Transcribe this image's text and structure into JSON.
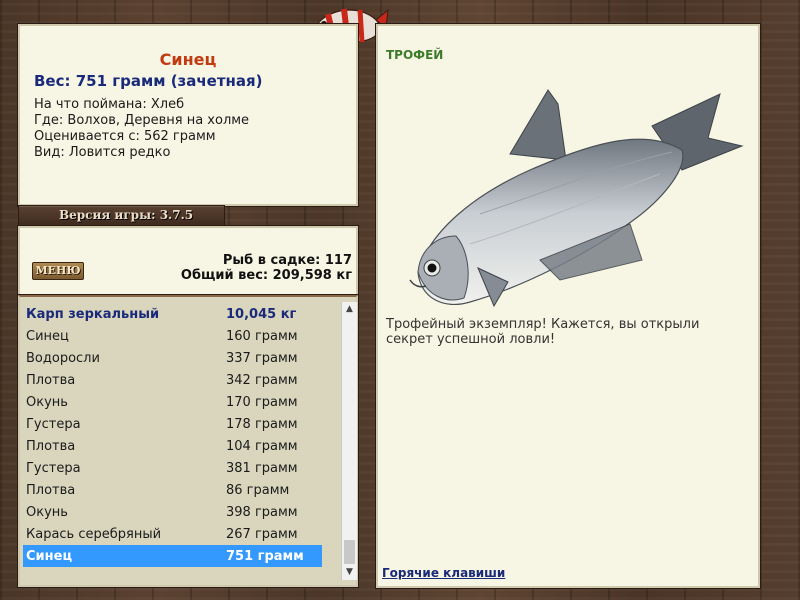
{
  "catch": {
    "name": "Синец",
    "weight": "Вес: 751 грамм (зачетная)",
    "bait": "На что поймана: Хлеб",
    "place": "Где: Волхов, Деревня на холме",
    "rated_from": "Оценивается с: 562 грамм",
    "kind": "Вид: Ловится редко"
  },
  "version": {
    "label": "Версия игры: 3.7.5"
  },
  "menu": {
    "label": "МЕНЮ"
  },
  "stats": {
    "count": "Рыб в садке: 117",
    "total": "Общий вес: 209,598 кг"
  },
  "list": {
    "header": {
      "name": "Карп зеркальный",
      "weight": "10,045 кг"
    },
    "items": [
      {
        "name": "Синец",
        "weight": "160 грамм"
      },
      {
        "name": "Водоросли",
        "weight": "337 грамм"
      },
      {
        "name": "Плотва",
        "weight": "342 грамм"
      },
      {
        "name": "Окунь",
        "weight": "170 грамм"
      },
      {
        "name": "Густера",
        "weight": "178 грамм"
      },
      {
        "name": "Плотва",
        "weight": "104 грамм"
      },
      {
        "name": "Густера",
        "weight": "381 грамм"
      },
      {
        "name": "Плотва",
        "weight": "86 грамм"
      },
      {
        "name": "Окунь",
        "weight": "398 грамм"
      },
      {
        "name": "Карась серебряный",
        "weight": "267 грамм"
      },
      {
        "name": "Синец",
        "weight": "751 грамм"
      }
    ]
  },
  "trophy": {
    "label": "ТРОФЕЙ",
    "text": "Трофейный экземпляр! Кажется, вы открыли секрет успешной ловли!"
  },
  "hotkeys": {
    "label": "Горячие клавиши"
  },
  "colors": {
    "accent_name": "#c03a12",
    "accent_blue": "#1a2a7a",
    "selection": "#3399ff",
    "trophy_green": "#3d7a2a"
  }
}
